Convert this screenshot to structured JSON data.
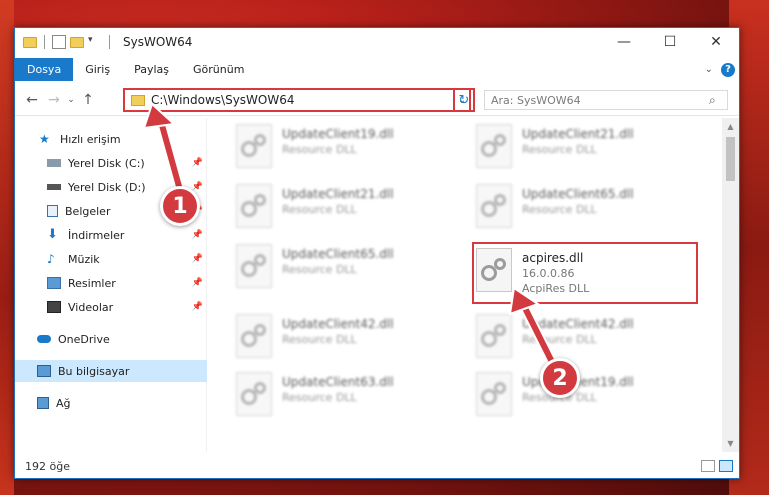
{
  "window": {
    "title": "SysWOW64"
  },
  "ribbon": {
    "tabs": [
      {
        "label": "Dosya"
      },
      {
        "label": "Giriş"
      },
      {
        "label": "Paylaş"
      },
      {
        "label": "Görünüm"
      }
    ]
  },
  "address": {
    "path": "C:\\Windows\\SysWOW64"
  },
  "search": {
    "placeholder": "Ara: SysWOW64"
  },
  "nav": {
    "items": [
      {
        "label": "Hızlı erişim"
      },
      {
        "label": "Yerel Disk (C:)"
      },
      {
        "label": "Yerel Disk (D:)"
      },
      {
        "label": "Belgeler"
      },
      {
        "label": "İndirmeler"
      },
      {
        "label": "Müzik"
      },
      {
        "label": "Resimler"
      },
      {
        "label": "Videolar"
      },
      {
        "label": "OneDrive"
      },
      {
        "label": "Bu bilgisayar"
      },
      {
        "label": "Ağ"
      }
    ]
  },
  "files": [
    {
      "name": "UpdateClient19.dll",
      "line1": "Resource DLL",
      "line2": ""
    },
    {
      "name": "UpdateClient21.dll",
      "line1": "Resource DLL",
      "line2": ""
    },
    {
      "name": "UpdateClient21.dll",
      "line1": "Resource DLL",
      "line2": ""
    },
    {
      "name": "UpdateClient65.dll",
      "line1": "Resource DLL",
      "line2": ""
    },
    {
      "name": "UpdateClient65.dll",
      "line1": "Resource DLL",
      "line2": ""
    },
    {
      "name": "acpires.dll",
      "line1": "16.0.0.86",
      "line2": "AcpiRes DLL"
    },
    {
      "name": "UpdateClient42.dll",
      "line1": "Resource DLL",
      "line2": ""
    },
    {
      "name": "UpdateClient42.dll",
      "line1": "Resource DLL",
      "line2": ""
    },
    {
      "name": "UpdateClient63.dll",
      "line1": "Resource DLL",
      "line2": ""
    },
    {
      "name": "UpdateClient19.dll",
      "line1": "Resource DLL",
      "line2": ""
    }
  ],
  "status": {
    "count": "192 öğe"
  },
  "annotations": {
    "badge1": "1",
    "badge2": "2"
  },
  "colors": {
    "accent": "#1979ca",
    "highlight": "#d9393e",
    "selected": "#cce8ff"
  }
}
